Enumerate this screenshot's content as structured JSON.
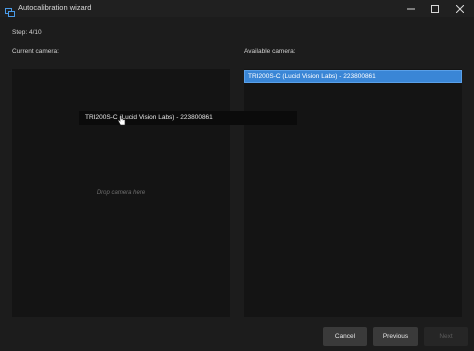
{
  "window": {
    "title": "Autocalibration wizard",
    "minimize_icon": "minimize-icon",
    "maximize_icon": "maximize-icon",
    "close_icon": "close-icon"
  },
  "wizard": {
    "step_label": "Step: 4/10",
    "current_camera_label": "Current camera:",
    "available_camera_label": "Available camera:",
    "drop_hint": "Drop camera here",
    "available_cameras": [
      {
        "label": "TRI200S-C (Lucid Vision Labs) - 223800861",
        "selected": true
      }
    ],
    "dragging_item": "TRI200S-C (Lucid Vision Labs) - 223800861"
  },
  "footer": {
    "cancel_label": "Cancel",
    "previous_label": "Previous",
    "next_label": "Next",
    "next_enabled": false
  },
  "colors": {
    "accent": "#3a86d6",
    "window_bg": "#1c1c1c",
    "panel_bg": "#141414"
  }
}
